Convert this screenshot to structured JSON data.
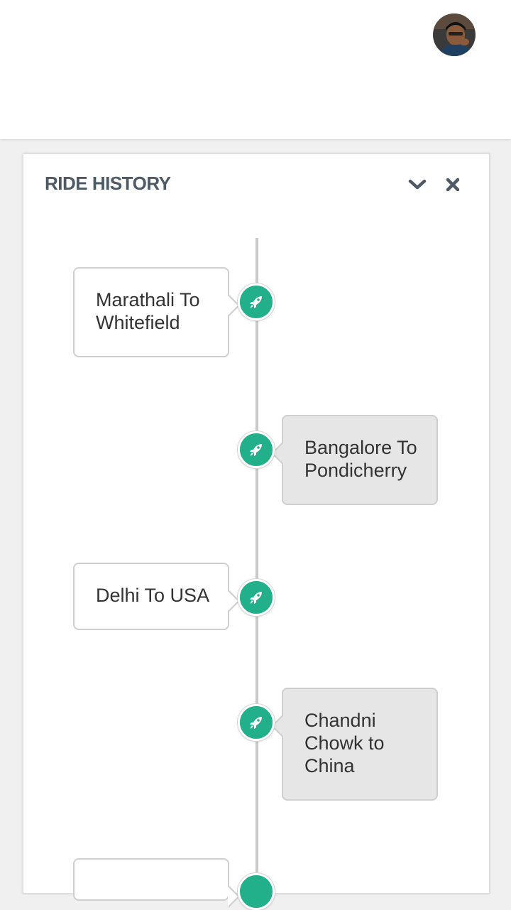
{
  "header": {
    "avatar_icon": "user-avatar"
  },
  "panel": {
    "title": "RIDE HISTORY",
    "collapse_icon": "chevron-down-icon",
    "close_icon": "close-icon"
  },
  "rides": [
    {
      "label": "Marathali To Whitefield",
      "side": "left"
    },
    {
      "label": "Bangalore To Pondicherry",
      "side": "right"
    },
    {
      "label": "Delhi To USA",
      "side": "left"
    },
    {
      "label": "Chandni Chowk to China",
      "side": "right"
    }
  ],
  "colors": {
    "accent": "#22b08a",
    "title": "#4d5a66"
  }
}
